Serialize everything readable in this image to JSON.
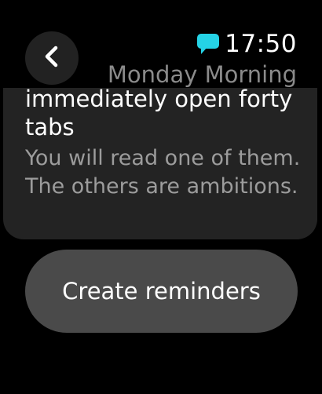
{
  "status": {
    "time": "17:50",
    "notification_icon": "message-bubble-icon",
    "accent_color": "#25d3e6"
  },
  "header": {
    "subtitle": "Monday Morning",
    "back_icon": "chevron-left-icon"
  },
  "card": {
    "title": "immediately open forty tabs",
    "body": "You will read one of them. The others are ambitions."
  },
  "actions": {
    "create_label": "Create reminders"
  }
}
